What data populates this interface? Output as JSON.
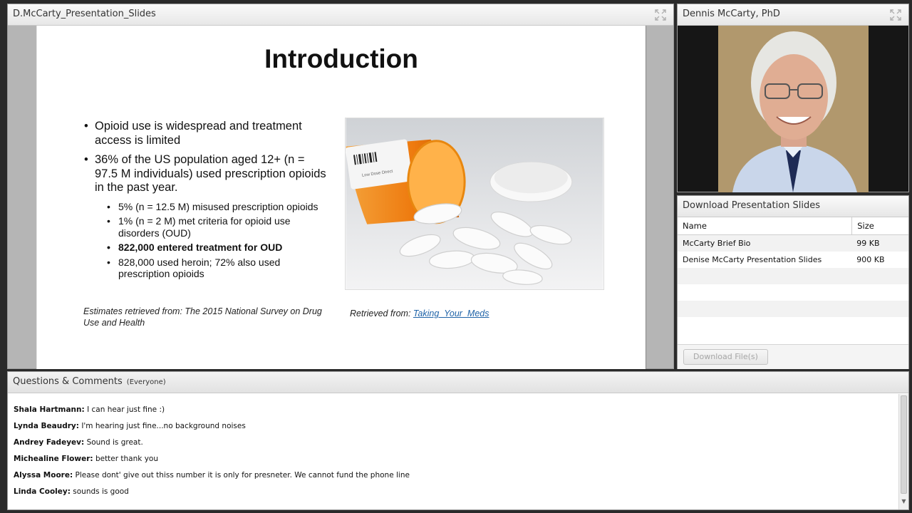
{
  "slides_pod": {
    "title": "D.McCarty_Presentation_Slides",
    "slide": {
      "title": "Introduction",
      "bullets": [
        "Opioid use is widespread and treatment access is limited",
        "36% of the US population aged 12+ (n = 97.5 M individuals) used prescription opioids in the past year."
      ],
      "sub_bullets": [
        "5% (n = 12.5 M) misused prescription opioids",
        "1% (n = 2 M) met criteria for opioid use disorders (OUD)",
        "822,000 entered treatment for OUD",
        "828,000 used heroin; 72% also used prescription opioids"
      ],
      "estimates_note": "Estimates retrieved from: The 2015 National Survey on Drug Use and Health",
      "retrieved_prefix": "Retrieved from: ",
      "retrieved_link": "Taking_Your_Meds",
      "bottle_label": "Low Dose Direct"
    }
  },
  "camera_pod": {
    "title": "Dennis McCarty, PhD"
  },
  "download_pod": {
    "title": "Download Presentation Slides",
    "columns": {
      "name": "Name",
      "size": "Size"
    },
    "files": [
      {
        "name": "McCarty Brief Bio",
        "size": "99 KB"
      },
      {
        "name": "Denise McCarty Presentation Slides",
        "size": "900 KB"
      }
    ],
    "button_label": "Download File(s)"
  },
  "chat_pod": {
    "title": "Questions & Comments",
    "scope": "(Everyone)",
    "messages": [
      {
        "author": "Shala Hartmann:",
        "text": "I can hear just fine :)"
      },
      {
        "author": "Lynda Beaudry:",
        "text": "I'm hearing just fine...no background noises"
      },
      {
        "author": "Andrey Fadeyev:",
        "text": "Sound is great."
      },
      {
        "author": "Michealine Flower:",
        "text": "better thank you"
      },
      {
        "author": "Alyssa Moore:",
        "text": "Please dont' give out thiss number it is only for presneter. We cannot fund the phone line"
      },
      {
        "author": "Linda Cooley:",
        "text": "sounds is good"
      }
    ]
  },
  "colors": {
    "link": "#1f63a8",
    "pill_bottle": "#f07a10",
    "pod_header": "#eaeaea"
  }
}
